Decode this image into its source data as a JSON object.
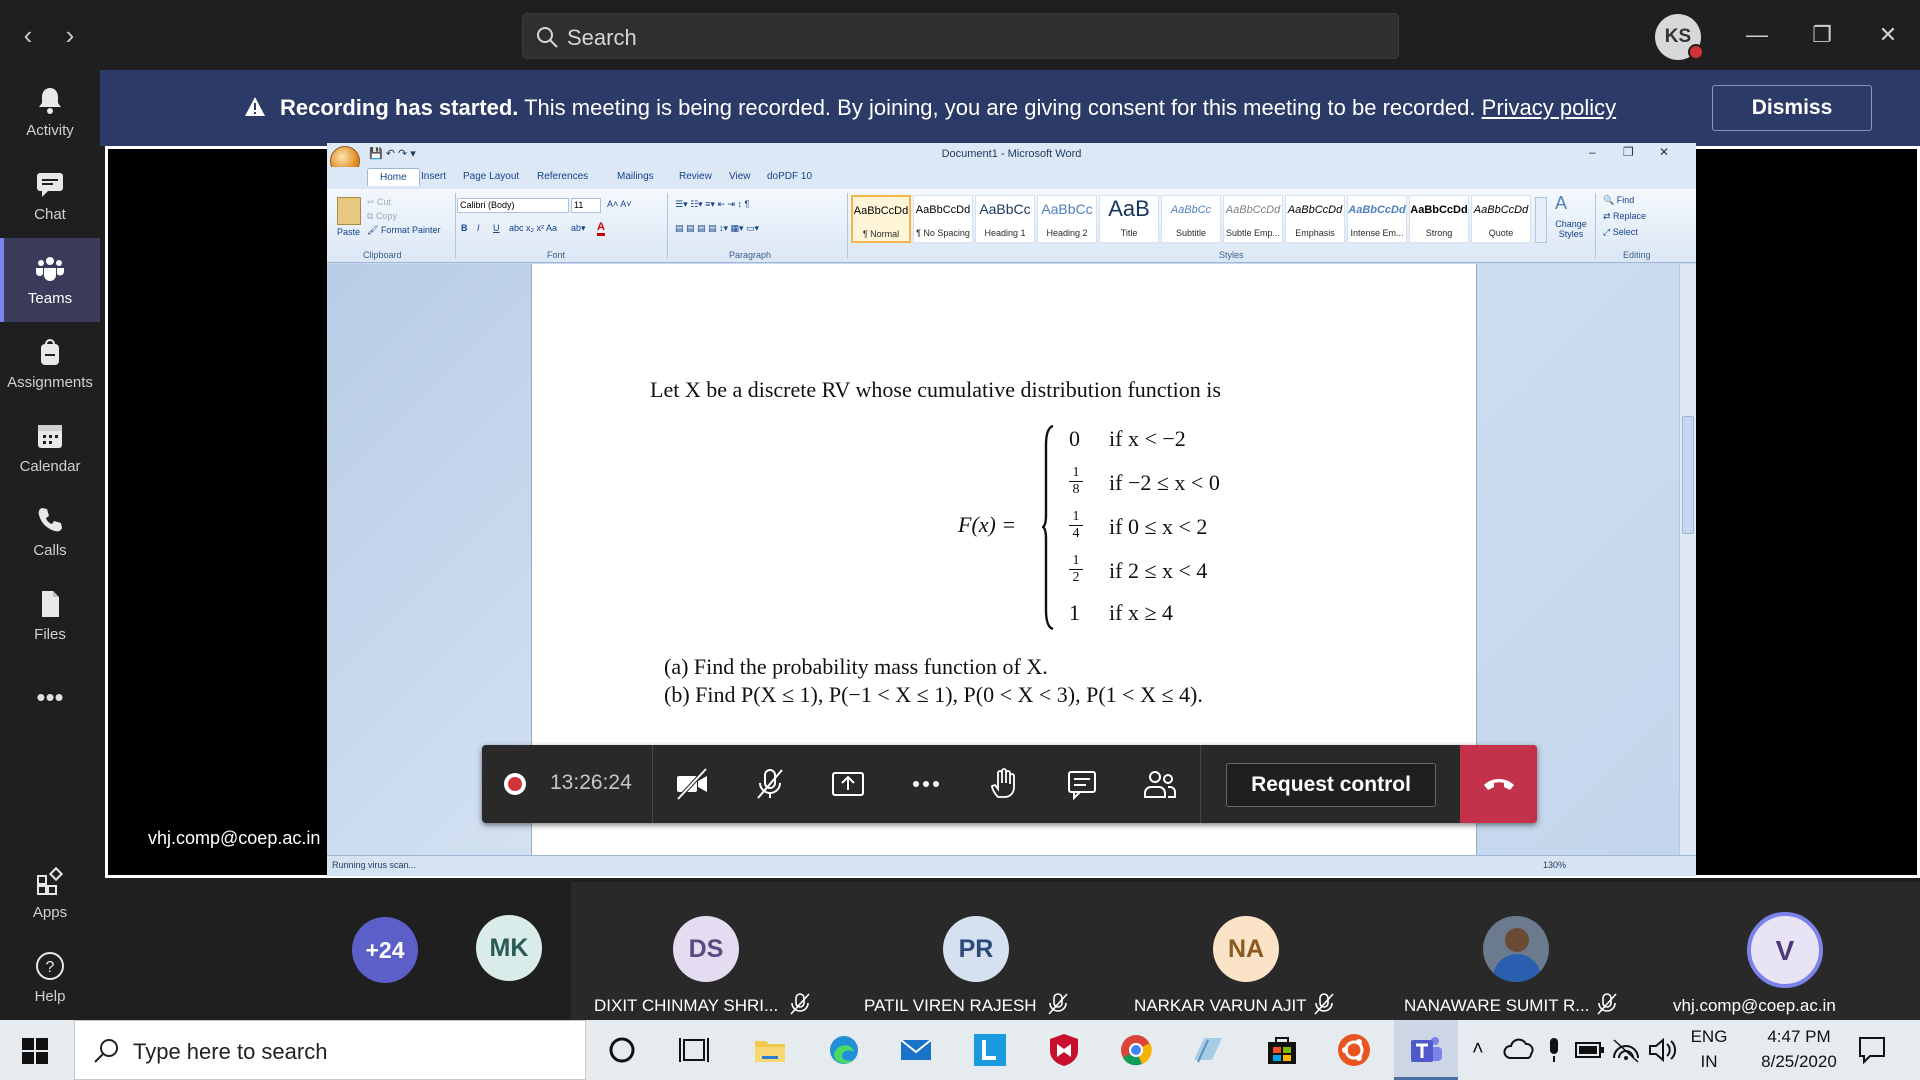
{
  "titlebar": {
    "search_placeholder": "Search",
    "avatar_initials": "KS"
  },
  "rail": {
    "items": [
      {
        "label": "Activity",
        "icon": "bell-icon"
      },
      {
        "label": "Chat",
        "icon": "chat-icon"
      },
      {
        "label": "Teams",
        "icon": "teams-icon",
        "active": true
      },
      {
        "label": "Assignments",
        "icon": "backpack-icon"
      },
      {
        "label": "Calendar",
        "icon": "calendar-icon"
      },
      {
        "label": "Calls",
        "icon": "phone-icon"
      },
      {
        "label": "Files",
        "icon": "file-icon"
      },
      {
        "label": "Apps",
        "icon": "apps-icon"
      },
      {
        "label": "Help",
        "icon": "help-icon"
      }
    ]
  },
  "banner": {
    "bold": "Recording has started.",
    "text": " This meeting is being recorded. By joining, you are giving consent for this meeting to be recorded. ",
    "link": "Privacy policy",
    "dismiss": "Dismiss"
  },
  "presenter": {
    "name": "vhj.comp@coep.ac.in"
  },
  "word": {
    "title": "Document1 - Microsoft Word",
    "tabs": [
      "Home",
      "Insert",
      "Page Layout",
      "References",
      "Mailings",
      "Review",
      "View",
      "doPDF 10"
    ],
    "clipboard": {
      "paste": "Paste",
      "cut": "Cut",
      "copy": "Copy",
      "format_painter": "Format Painter",
      "group": "Clipboard"
    },
    "font": {
      "name": "Calibri (Body)",
      "size": "11",
      "group": "Font"
    },
    "paragraph_group": "Paragraph",
    "styles": [
      {
        "preview": "AaBbCcDd",
        "name": "¶ Normal"
      },
      {
        "preview": "AaBbCcDd",
        "name": "¶ No Spacing"
      },
      {
        "preview": "AaBbCc",
        "name": "Heading 1"
      },
      {
        "preview": "AaBbCc",
        "name": "Heading 2"
      },
      {
        "preview": "AaB",
        "name": "Title"
      },
      {
        "preview": "AaBbCc",
        "name": "Subtitle"
      },
      {
        "preview": "AaBbCcDd",
        "name": "Subtle Emp..."
      },
      {
        "preview": "AaBbCcDd",
        "name": "Emphasis"
      },
      {
        "preview": "AaBbCcDd",
        "name": "Intense Em..."
      },
      {
        "preview": "AaBbCcDd",
        "name": "Strong"
      },
      {
        "preview": "AaBbCcDd",
        "name": "Quote"
      }
    ],
    "styles_group": "Styles",
    "change_styles": "Change Styles",
    "editing": {
      "find": "Find",
      "replace": "Replace",
      "select": "Select",
      "group": "Editing"
    },
    "status": "Running virus scan...",
    "zoom": "130%"
  },
  "document": {
    "intro": "Let X be a discrete RV whose cumulative distribution function is",
    "fx_label": "F(x) =",
    "cases": [
      {
        "value": "0",
        "cond": "if   x < −2"
      },
      {
        "num": "1",
        "den": "8",
        "cond": "if   −2 ≤ x < 0"
      },
      {
        "num": "1",
        "den": "4",
        "cond": "if   0 ≤ x < 2"
      },
      {
        "num": "1",
        "den": "2",
        "cond": "if   2 ≤ x < 4"
      },
      {
        "value": "1",
        "cond": "if   x ≥ 4"
      }
    ],
    "q_a": "(a)  Find the probability mass function of X.",
    "q_b": "(b)  Find P(X ≤ 1), P(−1 < X ≤ 1), P(0 < X < 3), P(1 < X ≤ 4)."
  },
  "meeting_toolbar": {
    "timer": "13:26:24",
    "request_control": "Request control"
  },
  "participants": [
    {
      "initials": "+24",
      "color": "#5b5fc7"
    },
    {
      "initials": "MK",
      "color": "#d9ece9"
    },
    {
      "initials": "DS",
      "name": "DIXIT CHINMAY SHRI...",
      "color": "#e4dcf0"
    },
    {
      "initials": "PR",
      "name": "PATIL VIREN RAJESH",
      "color": "#d5e1f0"
    },
    {
      "initials": "NA",
      "name": "NARKAR VARUN AJIT",
      "color": "#fbe3c8"
    },
    {
      "initials": "",
      "name": "NANAWARE SUMIT R...",
      "color": "#6b7a8c"
    },
    {
      "initials": "V",
      "name": "vhj.comp@coep.ac.in",
      "color": "#e9e4f5"
    }
  ],
  "taskbar": {
    "search_placeholder": "Type here to search",
    "lang_top": "ENG",
    "lang_bottom": "IN",
    "time": "4:47 PM",
    "date": "8/25/2020"
  }
}
